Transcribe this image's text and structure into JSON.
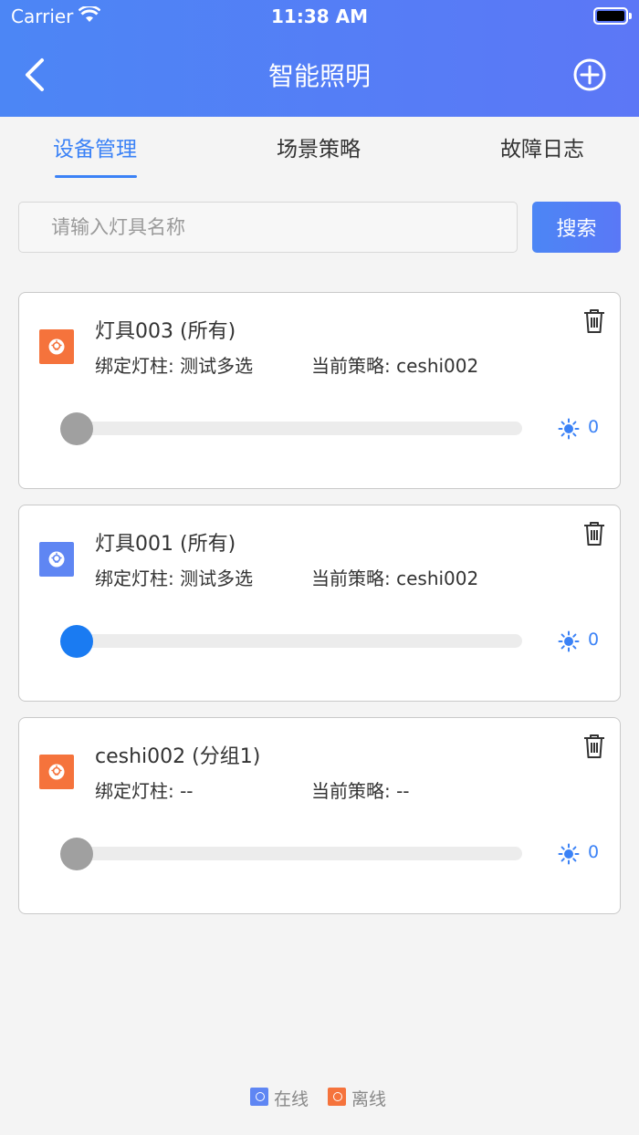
{
  "status_bar": {
    "carrier": "Carrier",
    "time": "11:38 AM"
  },
  "header": {
    "title": "智能照明"
  },
  "tabs": [
    {
      "label": "设备管理",
      "active": true
    },
    {
      "label": "场景策略",
      "active": false
    },
    {
      "label": "故障日志",
      "active": false
    }
  ],
  "search": {
    "placeholder": "请输入灯具名称",
    "button_label": "搜索"
  },
  "devices": [
    {
      "name": "灯具003 (所有)",
      "pole": "绑定灯柱: 测试多选",
      "strategy": "当前策略: ceshi002",
      "status": "离线",
      "status_color": "#f5733c",
      "brightness": "0",
      "slider_color": "#a0a0a0"
    },
    {
      "name": "灯具001 (所有)",
      "pole": "绑定灯柱: 测试多选",
      "strategy": "当前策略: ceshi002",
      "status": "在线",
      "status_color": "#5f86f3",
      "brightness": "0",
      "slider_color": "#1a7bf2"
    },
    {
      "name": "ceshi002 (分组1)",
      "pole": "绑定灯柱: --",
      "strategy": "当前策略: --",
      "status": "离线",
      "status_color": "#f5733c",
      "brightness": "0",
      "slider_color": "#a0a0a0"
    }
  ],
  "legend": [
    {
      "label": "在线",
      "color": "#5f86f3"
    },
    {
      "label": "离线",
      "color": "#f5733c"
    }
  ],
  "icons": [
    "back-icon",
    "add-circle-icon",
    "trash-icon",
    "lamp-icon",
    "sun-icon",
    "wifi-icon",
    "battery-icon"
  ]
}
